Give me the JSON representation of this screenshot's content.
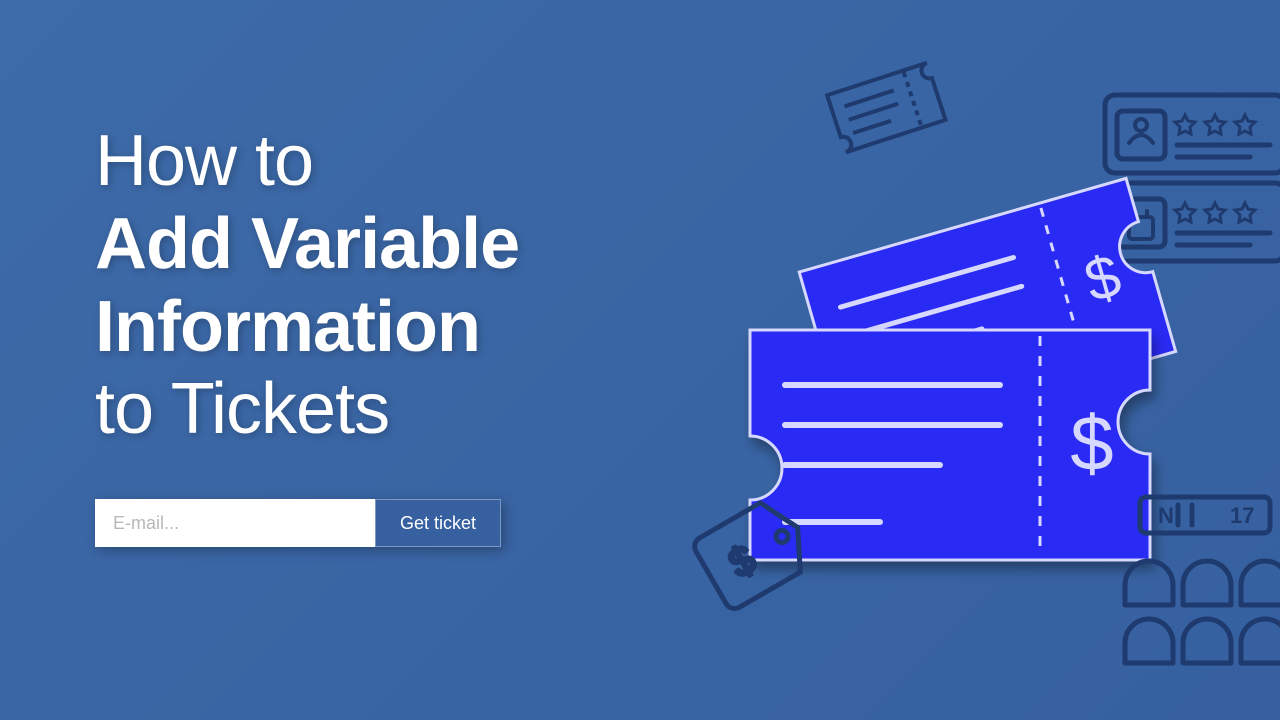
{
  "heading": {
    "line1": "How to",
    "line2": "Add Variable",
    "line3": "Information",
    "line4": "to Tickets"
  },
  "form": {
    "email_placeholder": "E-mail...",
    "button_label": "Get ticket"
  },
  "colors": {
    "background": "#3d6aa8",
    "ticket_fill": "#2a2af5",
    "outline": "#1e3a6e"
  },
  "icons": {
    "ticket_front": "ticket-dollar-icon",
    "ticket_back": "ticket-dollar-icon",
    "ticket_outline_small": "ticket-outline-icon",
    "price_tag": "price-tag-icon",
    "booking_card": "booking-card-icon",
    "theater_seats": "theater-seats-icon"
  }
}
